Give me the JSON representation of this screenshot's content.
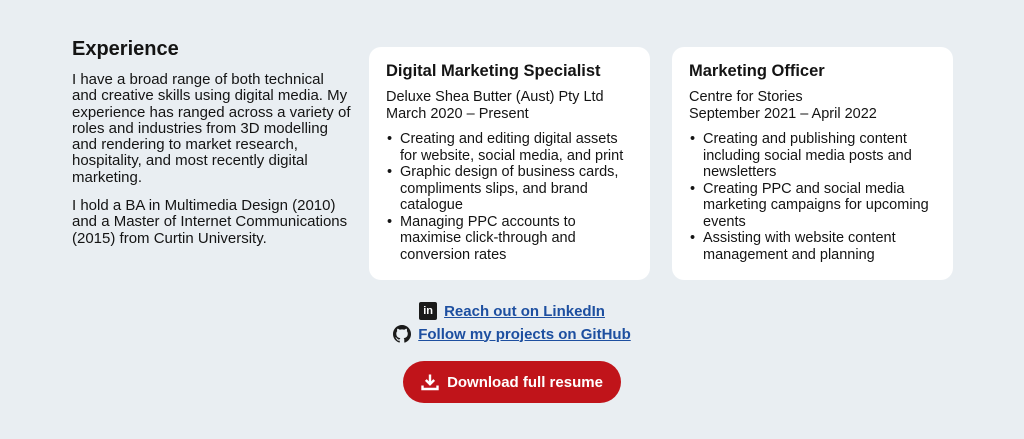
{
  "experience": {
    "heading": "Experience",
    "para1": "I have a broad range of both technical and creative skills using digital media. My experience has ranged across a variety of roles and industries from 3D modelling and rendering to market research, hospitality, and most recently digital marketing.",
    "para2": "I hold a BA in Multimedia Design (2010) and a Master of Internet Communications (2015) from Curtin University."
  },
  "jobs": [
    {
      "title": "Digital Marketing Specialist",
      "company": "Deluxe Shea Butter (Aust) Pty Ltd",
      "dates": "March 2020 – Present",
      "bullets": [
        "Creating and editing digital assets for website, social media, and print",
        "Graphic design of business cards, compliments slips, and brand catalogue",
        "Managing PPC accounts to maximise click-through and conversion rates"
      ]
    },
    {
      "title": "Marketing Officer",
      "company": "Centre for Stories",
      "dates": "September 2021 – April 2022",
      "bullets": [
        "Creating and publishing content including social media posts and newsletters",
        "Creating PPC and social media marketing campaigns for upcoming events",
        "Assisting with website content management and planning"
      ]
    }
  ],
  "links": {
    "linkedin_label": "Reach out on LinkedIn",
    "linkedin_icon": "linkedin-icon",
    "github_label": "Follow my projects on GitHub",
    "github_icon": "github-icon"
  },
  "download": {
    "label": "Download full resume",
    "icon": "download-icon",
    "color": "#c0141a"
  }
}
